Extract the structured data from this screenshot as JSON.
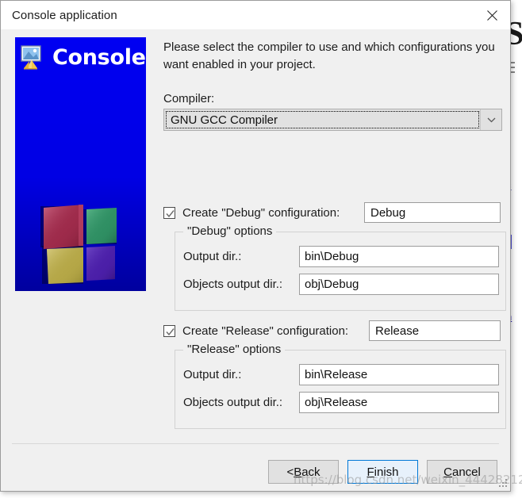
{
  "window": {
    "title": "Console application",
    "close_icon": "close-icon"
  },
  "banner": {
    "title": "Console",
    "icon": "console-app-icon",
    "logo": "codeblocks-cubes-logo"
  },
  "main": {
    "intro_text": "Please select the compiler to use and which configurations you want enabled in your project.",
    "compiler_label": "Compiler:",
    "compiler_value": "GNU GCC Compiler",
    "compiler_options": [
      "GNU GCC Compiler"
    ],
    "dropdown_icon": "chevron-down-icon"
  },
  "debug": {
    "checkbox_label": "Create \"Debug\" configuration:",
    "checked": true,
    "check_icon": "checkmark-icon",
    "name_value": "Debug",
    "group_title": "\"Debug\" options",
    "output_dir_label": "Output dir.:",
    "output_dir_value": "bin\\Debug",
    "objects_dir_label": "Objects output dir.:",
    "objects_dir_value": "obj\\Debug"
  },
  "release": {
    "checkbox_label": "Create \"Release\" configuration:",
    "checked": true,
    "check_icon": "checkmark-icon",
    "name_value": "Release",
    "group_title": "\"Release\" options",
    "output_dir_label": "Output dir.:",
    "output_dir_value": "bin\\Release",
    "objects_dir_label": "Objects output dir.:",
    "objects_dir_value": "obj\\Release"
  },
  "footer": {
    "back_prefix": "< ",
    "back_mnemonic": "B",
    "back_suffix": "ack",
    "finish_mnemonic": "F",
    "finish_suffix": "inish",
    "cancel_mnemonic": "C",
    "cancel_suffix": "ancel"
  },
  "overlay": {
    "watermark": "https://blog.csdn.net/weixin_44428212"
  },
  "background": {
    "big_letter": "S",
    "link_1": "c",
    "link_2": "n"
  },
  "colors": {
    "banner_blue": "#0000e4",
    "accent_blue": "#0078d7",
    "dialog_bg": "#f0f0f0",
    "field_bg": "#ffffff",
    "cube_red": "#a8304f",
    "cube_green": "#2f8f63",
    "cube_yellow": "#bfb04a",
    "cube_purple": "#4b1fa8"
  }
}
